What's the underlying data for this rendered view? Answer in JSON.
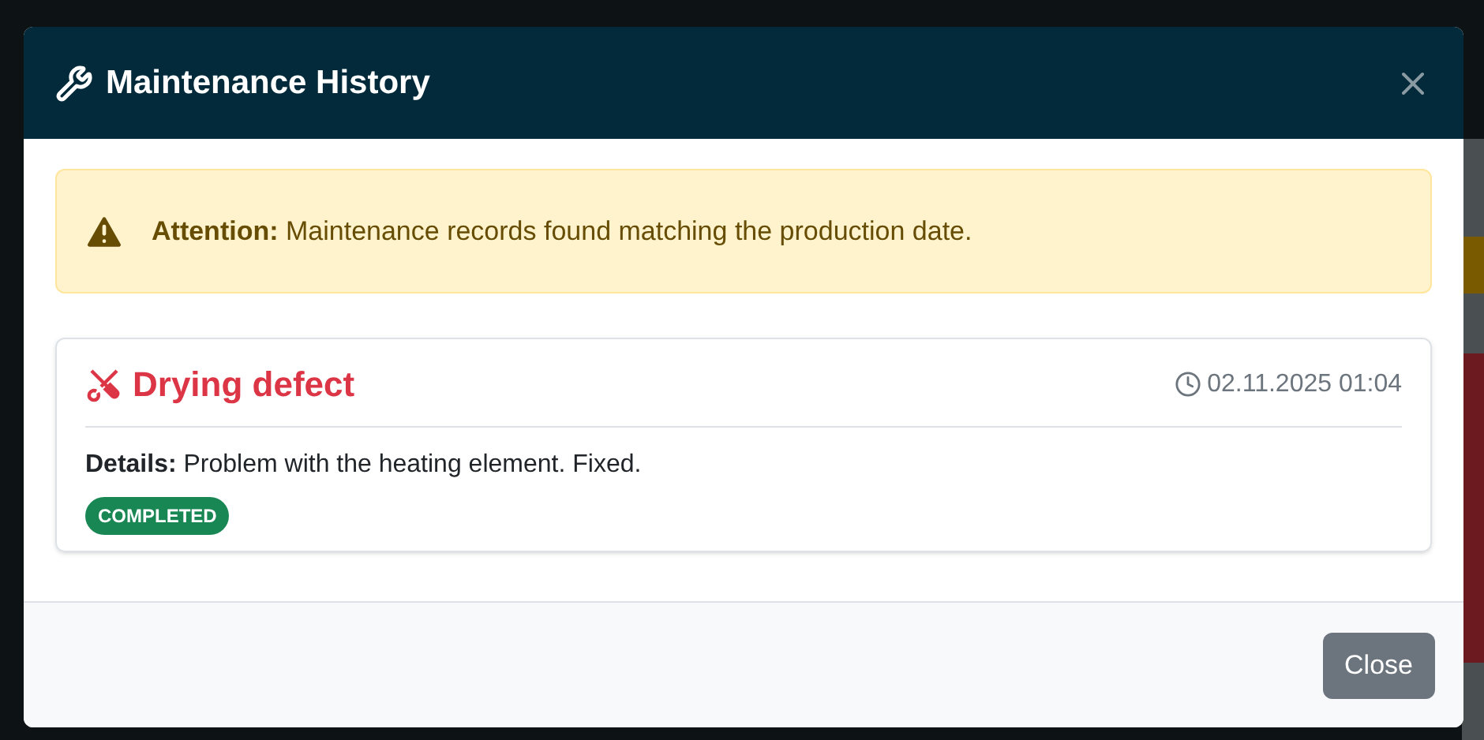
{
  "modal": {
    "title": "Maintenance History",
    "alert": {
      "label": "Attention:",
      "message": "Maintenance records found matching the production date."
    },
    "records": [
      {
        "title": "Drying defect",
        "timestamp": "02.11.2025 01:04",
        "details_label": "Details:",
        "details": "Problem with the heating element. Fixed.",
        "status": "COMPLETED",
        "color": "#198754"
      }
    ],
    "buttons": [
      "Close"
    ]
  }
}
